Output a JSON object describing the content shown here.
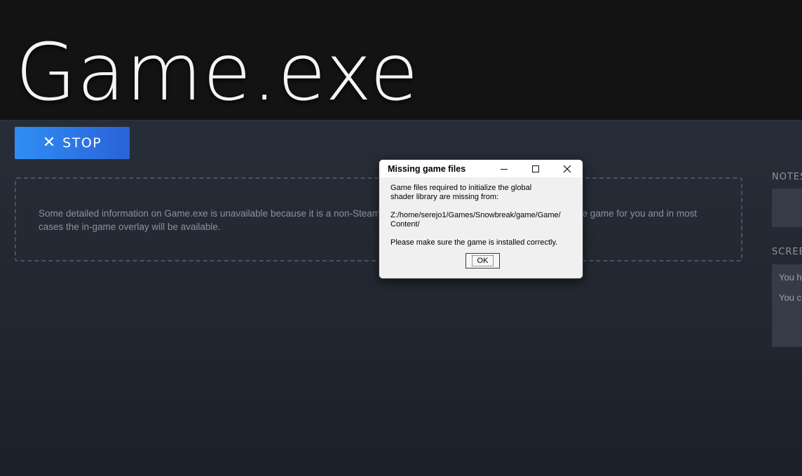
{
  "hero": {
    "title": "Game.exe"
  },
  "actions": {
    "stop_icon": "✕",
    "stop_label": "STOP"
  },
  "info": {
    "line1": "Some detailed information on Game.exe is unavailable because it is a non-Steam",
    "line1_end": "g the game for you and in most",
    "line2": "cases the in-game overlay will be available."
  },
  "sidebar": {
    "notes_label": "NOTES",
    "screenshots_label": "SCREE",
    "screenshots_line1": "You h",
    "screenshots_line2": "You c"
  },
  "dialog": {
    "title": "Missing game files",
    "minimize_icon": "minimize-icon",
    "maximize_icon": "maximize-icon",
    "close_icon": "close-icon",
    "msg_line1": "Game files required to initialize the global",
    "msg_line2": "shader library are missing from:",
    "msg_path1": "Z:/home/serejo1/Games/Snowbreak/game/Game/",
    "msg_path2": "Content/",
    "msg_line3": "Please make sure the game is installed correctly.",
    "ok_label": "OK"
  },
  "colors": {
    "accent_start": "#2f8ef2",
    "accent_end": "#2a62d9",
    "background": "#252b35",
    "hero_bg": "#131313"
  }
}
